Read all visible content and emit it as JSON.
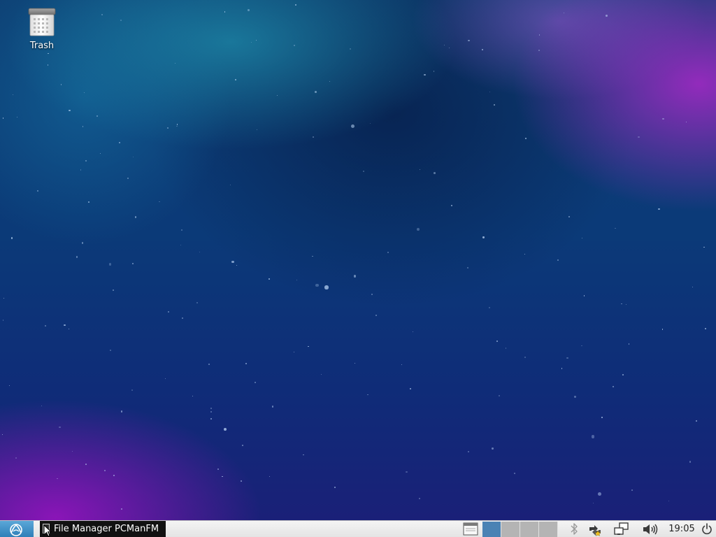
{
  "desktop": {
    "icons": [
      {
        "label": "Trash",
        "icon": "trash-icon"
      }
    ]
  },
  "taskbar": {
    "menu_button": {
      "icon": "app-menu-icon"
    },
    "tasks": [
      {
        "label": "File Manager PCManFM",
        "icon": "file-manager-icon"
      }
    ],
    "show_desktop": {
      "icon": "show-desktop-icon"
    },
    "pager": {
      "desktops": 4,
      "active_index": 0
    },
    "tray": [
      {
        "icon": "bluetooth-icon"
      },
      {
        "icon": "updates-icon"
      },
      {
        "icon": "network-icon"
      },
      {
        "icon": "volume-icon"
      }
    ],
    "clock": "19:05",
    "power": {
      "icon": "power-icon"
    }
  },
  "colors": {
    "taskbar_bg": "#ececec",
    "menu_button": "#3a8cc6",
    "active_desktop": "#4a82b4",
    "inactive_desktop": "#b4b4b4"
  }
}
